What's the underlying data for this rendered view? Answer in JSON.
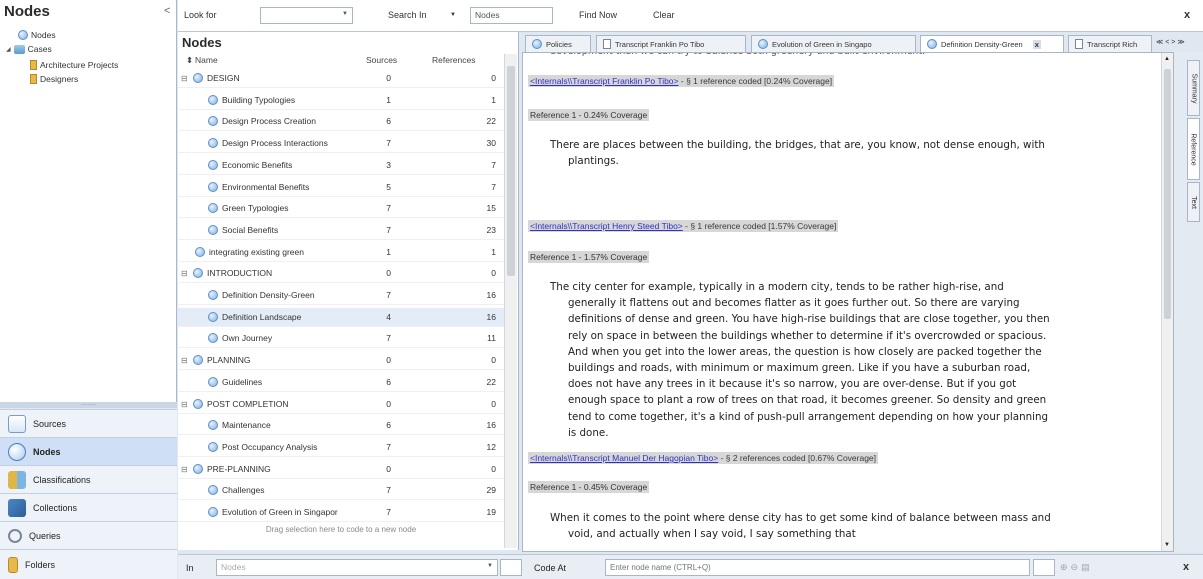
{
  "nav": {
    "title": "Nodes",
    "collapse_glyph": "<",
    "tree": [
      {
        "label": "Nodes",
        "icon": "node-icon"
      },
      {
        "label": "Cases",
        "icon": "case-icon"
      },
      {
        "label": "Architecture Projects",
        "icon": "folder-icon"
      },
      {
        "label": "Designers",
        "icon": "folder-icon"
      }
    ],
    "buttons": [
      {
        "label": "Sources",
        "icon": "sources-icon"
      },
      {
        "label": "Nodes",
        "icon": "nodes-icon"
      },
      {
        "label": "Classifications",
        "icon": "classifications-icon"
      },
      {
        "label": "Collections",
        "icon": "collections-icon"
      },
      {
        "label": "Queries",
        "icon": "queries-icon"
      },
      {
        "label": "Folders",
        "icon": "folders-icon"
      }
    ]
  },
  "toolbar": {
    "look_for_label": "Look for",
    "look_for_value": "",
    "search_in_label": "Search In",
    "search_in_value": "Nodes",
    "find_now": "Find Now",
    "clear": "Clear",
    "close": "x"
  },
  "list": {
    "title": "Nodes",
    "columns": {
      "name": "Name",
      "sources": "Sources",
      "references": "References"
    },
    "rows": [
      {
        "name": "DESIGN",
        "sources": "0",
        "references": "0",
        "level": 0,
        "expander": "⊟"
      },
      {
        "name": "Building Typologies",
        "sources": "1",
        "references": "1",
        "level": 1
      },
      {
        "name": "Design Process Creation",
        "sources": "6",
        "references": "22",
        "level": 1
      },
      {
        "name": "Design Process Interactions",
        "sources": "7",
        "references": "30",
        "level": 1
      },
      {
        "name": "Economic Benefits",
        "sources": "3",
        "references": "7",
        "level": 1
      },
      {
        "name": "Environmental Benefits",
        "sources": "5",
        "references": "7",
        "level": 1
      },
      {
        "name": "Green Typologies",
        "sources": "7",
        "references": "15",
        "level": 1
      },
      {
        "name": "Social Benefits",
        "sources": "7",
        "references": "23",
        "level": 1
      },
      {
        "name": "integrating existing green",
        "sources": "1",
        "references": "1",
        "level": 0
      },
      {
        "name": "INTRODUCTION",
        "sources": "0",
        "references": "0",
        "level": 0,
        "expander": "⊟"
      },
      {
        "name": "Definition Density-Green",
        "sources": "7",
        "references": "16",
        "level": 1
      },
      {
        "name": "Definition Landscape",
        "sources": "4",
        "references": "16",
        "level": 1
      },
      {
        "name": "Own Journey",
        "sources": "7",
        "references": "11",
        "level": 1
      },
      {
        "name": "PLANNING",
        "sources": "0",
        "references": "0",
        "level": 0,
        "expander": "⊟"
      },
      {
        "name": "Guidelines",
        "sources": "6",
        "references": "22",
        "level": 1
      },
      {
        "name": "POST COMPLETION",
        "sources": "0",
        "references": "0",
        "level": 0,
        "expander": "⊟"
      },
      {
        "name": "Maintenance",
        "sources": "6",
        "references": "16",
        "level": 1
      },
      {
        "name": "Post Occupancy Analysis",
        "sources": "7",
        "references": "12",
        "level": 1
      },
      {
        "name": "PRE-PLANNING",
        "sources": "0",
        "references": "0",
        "level": 0,
        "expander": "⊟"
      },
      {
        "name": "Challenges",
        "sources": "7",
        "references": "29",
        "level": 1
      },
      {
        "name": "Evolution of Green in Singapor",
        "sources": "7",
        "references": "19",
        "level": 1
      }
    ],
    "drag_hint": "Drag selection here to code to a new node"
  },
  "tabs": [
    {
      "label": "Policies",
      "icon": "node-icon"
    },
    {
      "label": "Transcript Franklin Po Tibo",
      "icon": "document-icon"
    },
    {
      "label": "Evolution of Green in Singapo",
      "icon": "node-icon"
    },
    {
      "label": "Definition Density-Green",
      "icon": "node-icon",
      "active": true
    },
    {
      "label": "Transcript Rich",
      "icon": "document-icon"
    }
  ],
  "tab_nav": "≪ < > ≫",
  "detail": {
    "top_cut_text": "development than we can try to balance both greenery and built environment.",
    "blocks": [
      {
        "link": "<Internals\\\\Transcript Franklin Po Tibo>",
        "summary": " - § 1 reference coded  [0.24% Coverage]",
        "ref": "Reference 1 - 0.24% Coverage",
        "text": "There are places between the building, the bridges, that are, you know, not dense enough, with plantings."
      },
      {
        "link": "<Internals\\\\Transcript Henry Steed Tibo>",
        "summary": " - § 1 reference coded  [1.57% Coverage]",
        "ref": "Reference 1 - 1.57% Coverage",
        "text": "The city center for example, typically in a modern city, tends to be rather high-rise, and generally it flattens out and becomes flatter as it goes further out. So there are varying definitions of dense and green. You have high-rise buildings that are close together, you then rely on space in between the buildings whether to determine if it's overcrowded or spacious. And when you get into the lower areas, the question is how closely are packed together the buildings and roads, with minimum or maximum green. Like if you have a suburban road, does not have any trees in it because it's so narrow, you are over-dense. But if you got enough space to plant a row of trees on that road, it becomes greener. So density and green tend to come together, it's a kind of push-pull arrangement depending on how your planning is done."
      },
      {
        "link": "<Internals\\\\Transcript Manuel Der Hagopian Tibo>",
        "summary": " - § 2 references coded  [0.67% Coverage]",
        "ref": "Reference 1 - 0.45% Coverage",
        "text": "When it comes to the point where dense city has to get some kind of balance between mass and void, and actually when I say void, I say something that"
      }
    ]
  },
  "side_tabs": [
    "Summary",
    "Reference",
    "Text"
  ],
  "bottom": {
    "in_label": "In",
    "in_value": "Nodes",
    "code_at_label": "Code At",
    "code_at_placeholder": "Enter node name (CTRL+Q)",
    "close": "x"
  }
}
